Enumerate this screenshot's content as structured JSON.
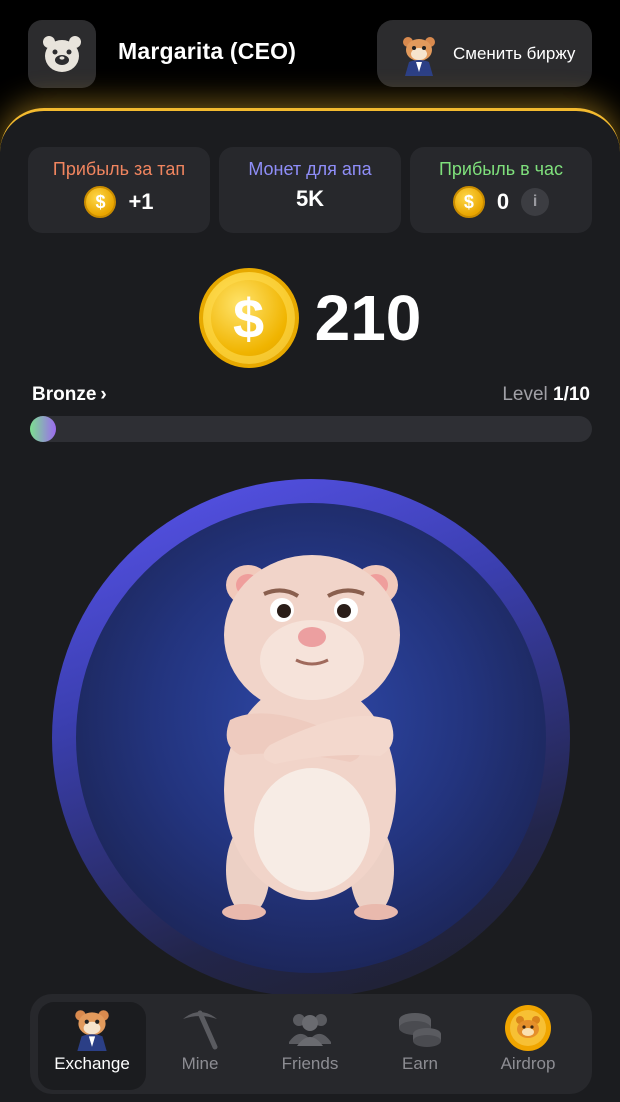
{
  "header": {
    "username": "Margarita (CEO)",
    "switch_exchange_label": "Сменить биржу"
  },
  "stats": {
    "profit_per_tap": {
      "title": "Прибыль за тап",
      "value": "+1",
      "color": "#f0855f"
    },
    "coins_to_level_up": {
      "title": "Монет для апа",
      "value": "5K",
      "color": "#8f8ef8"
    },
    "profit_per_hour": {
      "title": "Прибыль в час",
      "value": "0",
      "color": "#7fe07c"
    }
  },
  "balance": {
    "value": "210"
  },
  "league": {
    "name": "Bronze",
    "level_label": "Level",
    "level_value": "1/10",
    "progress": 0.04
  },
  "nav": [
    {
      "label": "Exchange",
      "icon": "hamster-ceo-icon",
      "active": true
    },
    {
      "label": "Mine",
      "icon": "pickaxe-icon",
      "active": false
    },
    {
      "label": "Friends",
      "icon": "friends-icon",
      "active": false
    },
    {
      "label": "Earn",
      "icon": "coins-stack-icon",
      "active": false
    },
    {
      "label": "Airdrop",
      "icon": "hamster-coin-icon",
      "active": false
    }
  ],
  "colors": {
    "accent": "#f3ba2f",
    "panel": "#1b1c1f",
    "card": "#27282c",
    "ring": "#5a55f0"
  }
}
